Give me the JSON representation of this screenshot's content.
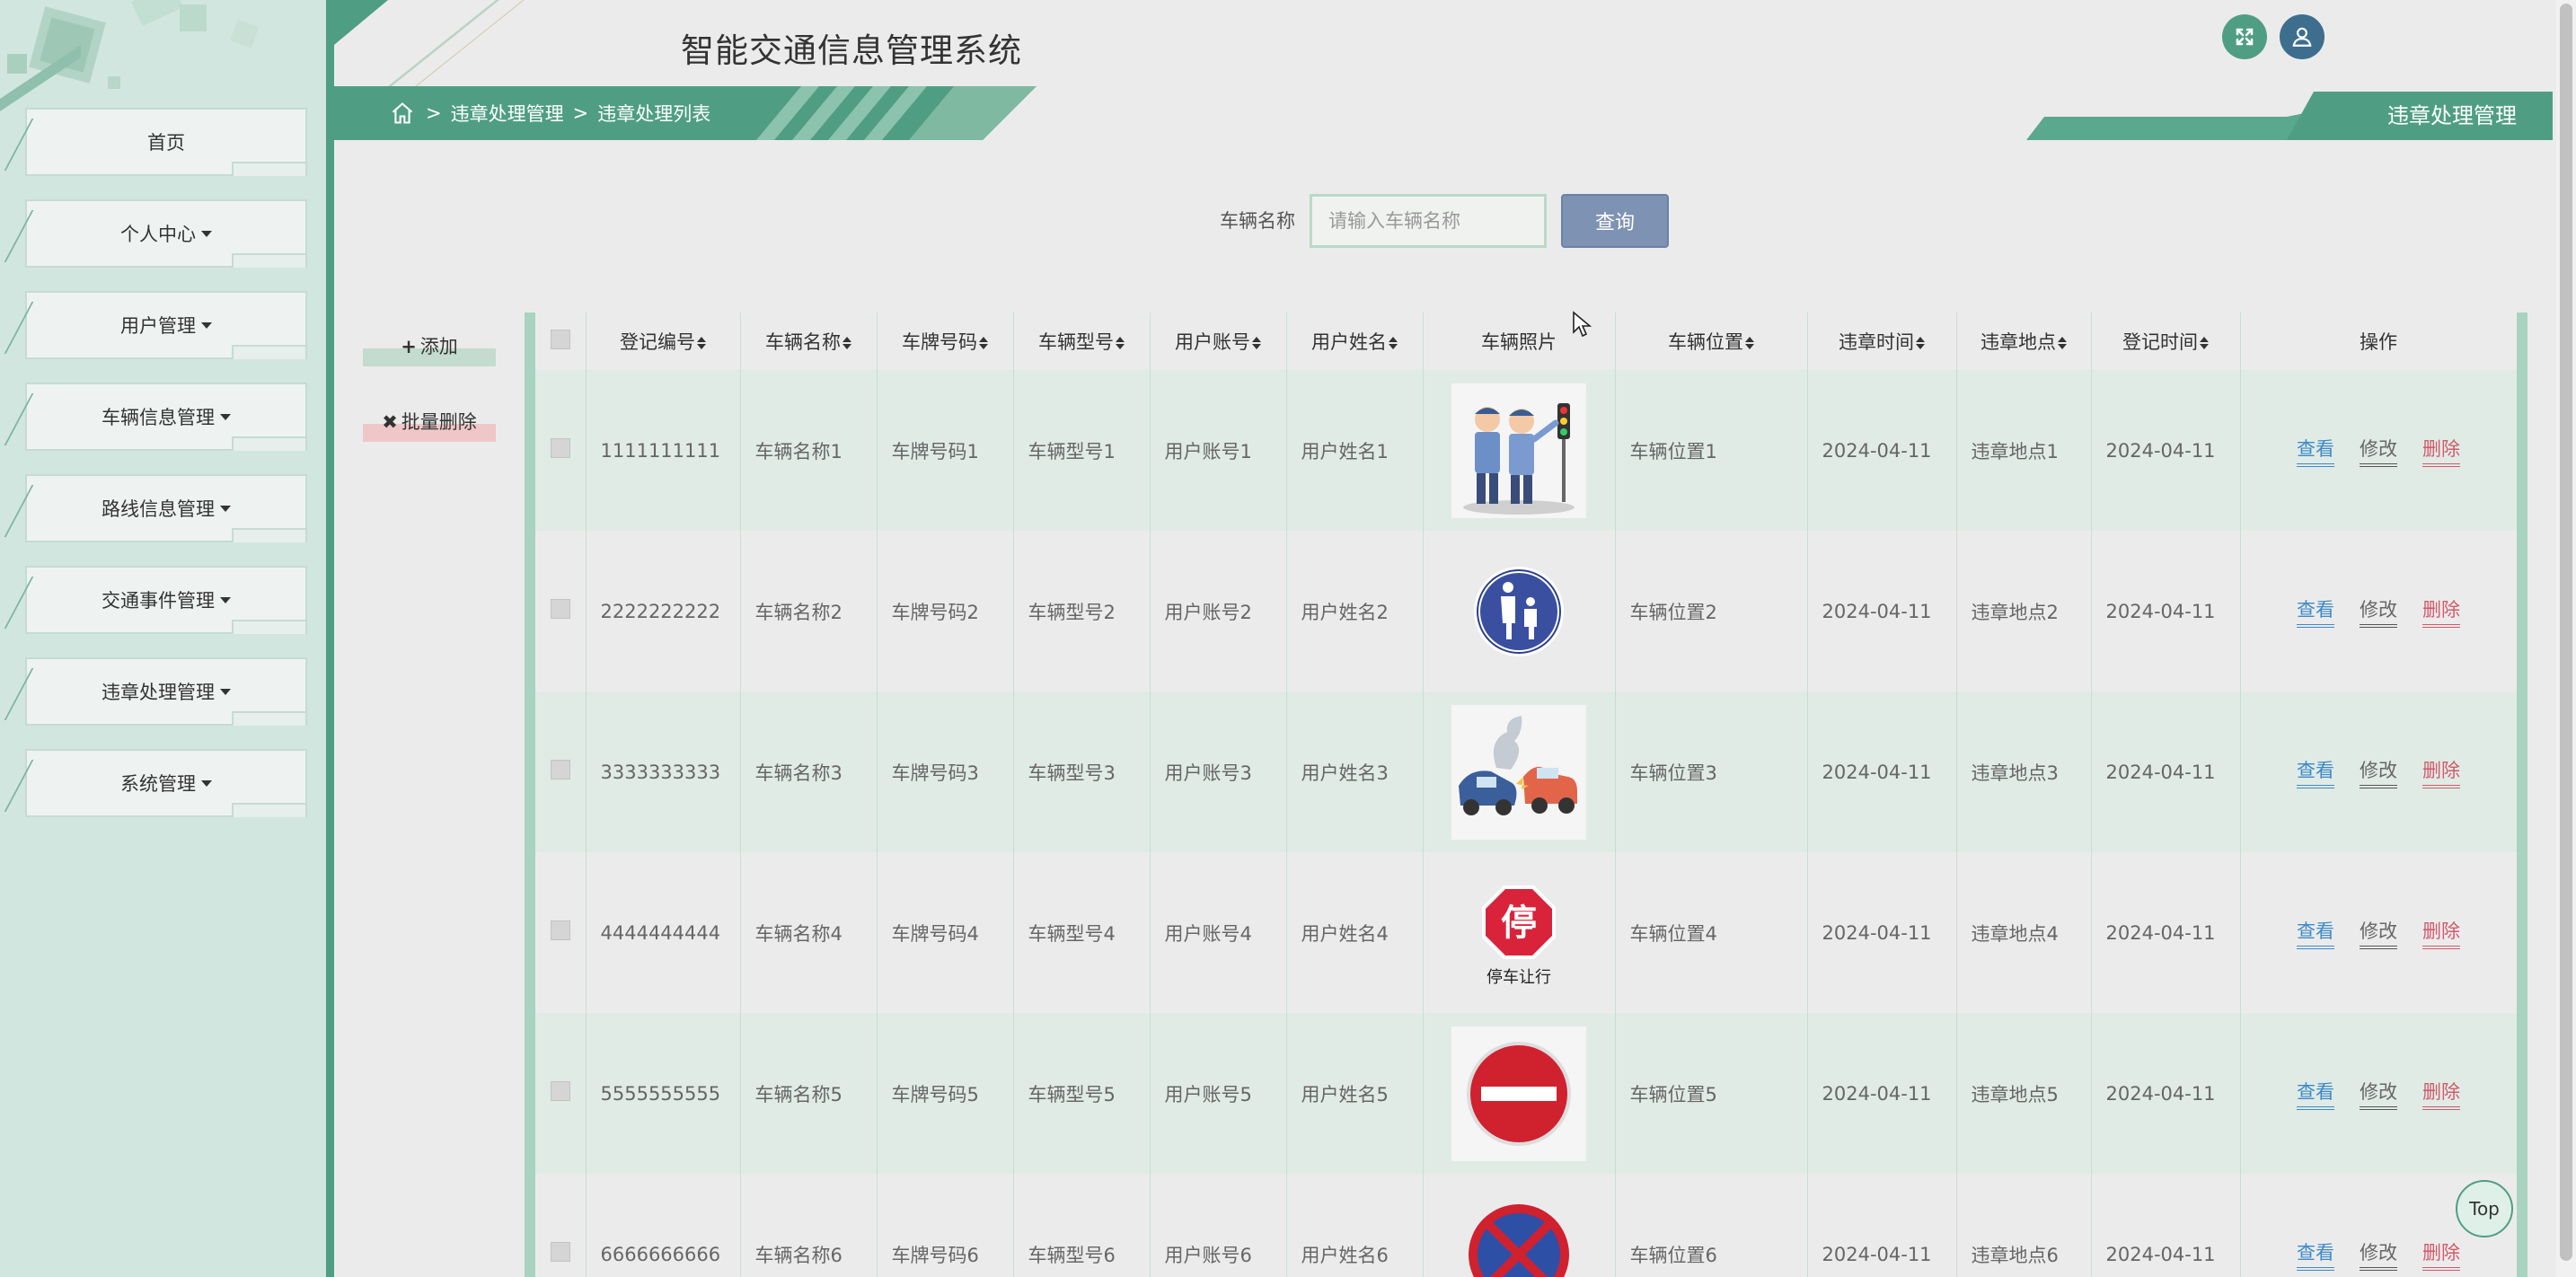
{
  "app": {
    "title": "智能交通信息管理系统"
  },
  "header": {
    "fullscreen_icon": "expand-icon",
    "user_icon": "user-icon",
    "accent": "#4f9e84"
  },
  "sidebar": {
    "items": [
      {
        "label": "首页",
        "dropdown": false
      },
      {
        "label": "个人中心",
        "dropdown": true
      },
      {
        "label": "用户管理",
        "dropdown": true
      },
      {
        "label": "车辆信息管理",
        "dropdown": true
      },
      {
        "label": "路线信息管理",
        "dropdown": true
      },
      {
        "label": "交通事件管理",
        "dropdown": true
      },
      {
        "label": "违章处理管理",
        "dropdown": true
      },
      {
        "label": "系统管理",
        "dropdown": true
      }
    ]
  },
  "breadcrumb": {
    "sep": ">",
    "level1": "违章处理管理",
    "level2": "违章处理列表"
  },
  "section_tag": "违章处理管理",
  "search": {
    "label": "车辆名称",
    "placeholder": "请输入车辆名称",
    "button": "查询"
  },
  "actions": {
    "add": "添加",
    "add_icon": "+",
    "bulk_delete": "批量删除",
    "bulk_delete_icon": "✖"
  },
  "table": {
    "columns": [
      "登记编号",
      "车辆名称",
      "车牌号码",
      "车辆型号",
      "用户账号",
      "用户姓名",
      "车辆照片",
      "车辆位置",
      "违章时间",
      "违章地点",
      "登记时间",
      "操作"
    ],
    "ops": {
      "view": "查看",
      "edit": "修改",
      "delete": "删除"
    },
    "rows": [
      {
        "id": "1111111111",
        "name": "车辆名称1",
        "plate": "车牌号码1",
        "model": "车辆型号1",
        "account": "用户账号1",
        "user": "用户姓名1",
        "photo": "traffic-police-illustration",
        "location": "车辆位置1",
        "vtime": "2024-04-11",
        "vplace": "违章地点1",
        "rtime": "2024-04-11"
      },
      {
        "id": "2222222222",
        "name": "车辆名称2",
        "plate": "车牌号码2",
        "model": "车辆型号2",
        "account": "用户账号2",
        "user": "用户姓名2",
        "photo": "pedestrian-sign",
        "location": "车辆位置2",
        "vtime": "2024-04-11",
        "vplace": "违章地点2",
        "rtime": "2024-04-11"
      },
      {
        "id": "3333333333",
        "name": "车辆名称3",
        "plate": "车牌号码3",
        "model": "车辆型号3",
        "account": "用户账号3",
        "user": "用户姓名3",
        "photo": "car-crash-illustration",
        "location": "车辆位置3",
        "vtime": "2024-04-11",
        "vplace": "违章地点3",
        "rtime": "2024-04-11"
      },
      {
        "id": "4444444444",
        "name": "车辆名称4",
        "plate": "车牌号码4",
        "model": "车辆型号4",
        "account": "用户账号4",
        "user": "用户姓名4",
        "photo": "stop-sign",
        "photo_text": "停",
        "photo_caption": "停车让行",
        "location": "车辆位置4",
        "vtime": "2024-04-11",
        "vplace": "违章地点4",
        "rtime": "2024-04-11"
      },
      {
        "id": "5555555555",
        "name": "车辆名称5",
        "plate": "车牌号码5",
        "model": "车辆型号5",
        "account": "用户账号5",
        "user": "用户姓名5",
        "photo": "no-entry-sign",
        "location": "车辆位置5",
        "vtime": "2024-04-11",
        "vplace": "违章地点5",
        "rtime": "2024-04-11"
      },
      {
        "id": "6666666666",
        "name": "车辆名称6",
        "plate": "车牌号码6",
        "model": "车辆型号6",
        "account": "用户账号6",
        "user": "用户姓名6",
        "photo": "no-parking-sign",
        "location": "车辆位置6",
        "vtime": "2024-04-11",
        "vplace": "违章地点6",
        "rtime": "2024-04-11"
      }
    ]
  },
  "top_button": "Top"
}
